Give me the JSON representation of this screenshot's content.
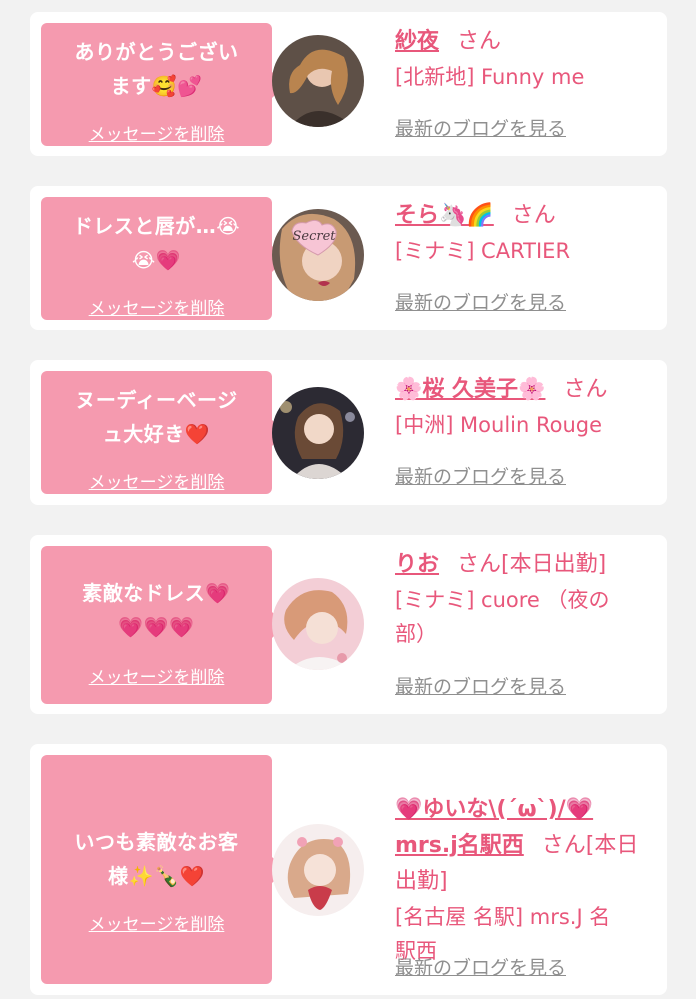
{
  "colors": {
    "accent": "#e8577b",
    "bubble": "#f59aaf",
    "link_gray": "#8f8f8f",
    "background": "#f2f2f2"
  },
  "delete_label": "メッセージを削除",
  "blog_label": "最新のブログを見る",
  "cards": [
    {
      "message": "ありがとうござい\nます🥰💕",
      "name": "紗夜",
      "suffix": "さん",
      "shop": "[北新地] Funny me",
      "avatar_icon": "girl-photo-avatar",
      "avatar_stamp": ""
    },
    {
      "message": "ドレスと唇が…😭\n😭💗",
      "name": "そら🦄🌈",
      "suffix": "さん",
      "shop": "[ミナミ] CARTIER",
      "avatar_icon": "secret-heart-avatar",
      "avatar_stamp": "Secret"
    },
    {
      "message": "ヌーディーベージ\nュ大好き❤️",
      "name": "🌸桜 久美子🌸",
      "suffix": "さん",
      "shop": "[中洲] Moulin Rouge",
      "avatar_icon": "girl-photo-avatar",
      "avatar_stamp": ""
    },
    {
      "message": "素敵なドレス💗\n💗💗💗",
      "name": "りお",
      "suffix": "さん[本日出勤]",
      "shop": "[ミナミ] cuore （夜の\n部）",
      "avatar_icon": "girl-photo-avatar",
      "avatar_stamp": ""
    },
    {
      "message": "いつも素敵なお客\n様✨🍾❤️",
      "name": "💗ゆいな\\(´ω`)/💗\nmrs.j名駅西",
      "suffix": "さん[本日\n出勤]",
      "shop": "[名古屋 名駅] mrs.J 名\n駅西",
      "avatar_icon": "girl-photo-avatar",
      "avatar_stamp": ""
    }
  ]
}
